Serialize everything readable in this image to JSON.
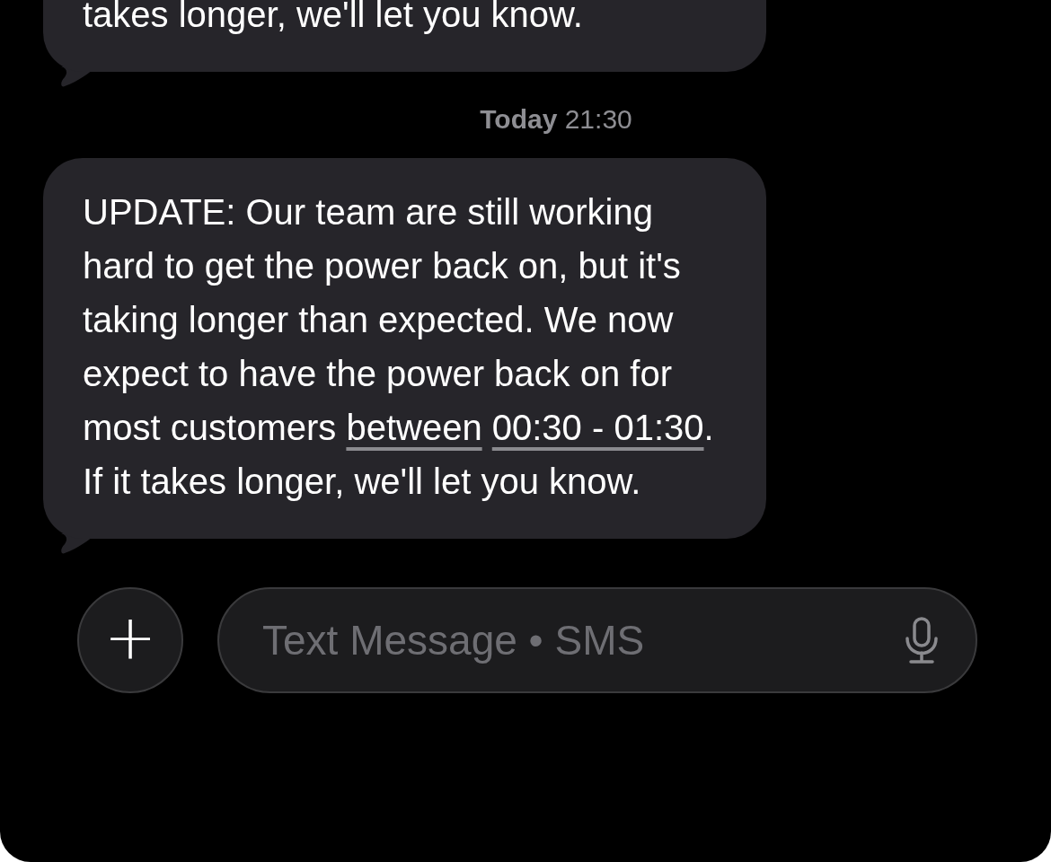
{
  "messages": [
    {
      "kind": "received",
      "parts": [
        {
          "kind": "text",
          "text": "takes longer, we'll let you know."
        }
      ],
      "cut": true
    },
    {
      "kind": "timestamp",
      "day": "Today",
      "time": "21:30"
    },
    {
      "kind": "received",
      "parts": [
        {
          "kind": "text",
          "text": "UPDATE: Our team are still working hard to get the power back on, but it's taking longer than expected. We now expect to have the power back on for most customers "
        },
        {
          "kind": "link",
          "text": "between"
        },
        {
          "kind": "link",
          "text": "00:30 - 01:30"
        },
        {
          "kind": "text",
          "text": ". If it takes longer, we'll let you know."
        }
      ],
      "cut": false
    }
  ],
  "composer": {
    "add": "+",
    "placeholder": "Text Message • SMS"
  }
}
